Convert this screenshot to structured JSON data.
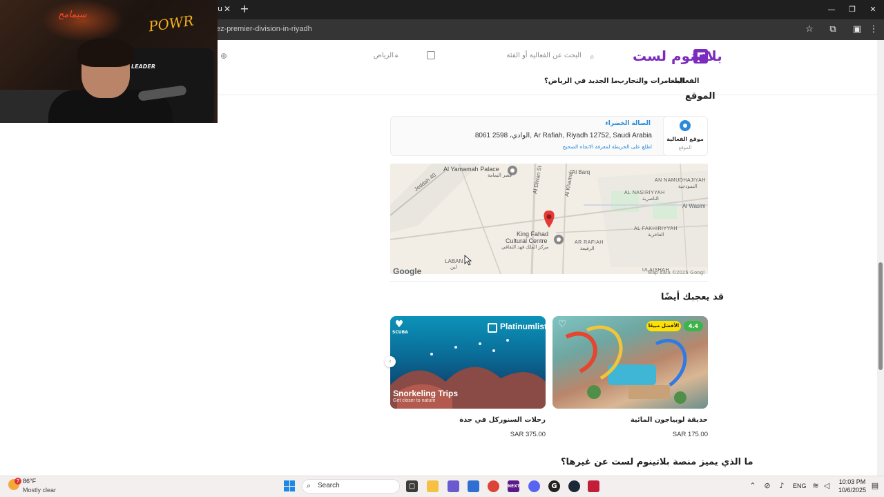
{
  "browser": {
    "tab_stub": "u",
    "url": "ez-premier-division-in-riyadh",
    "close_tab": "✕",
    "new_tab": "+",
    "win_min": "—",
    "win_max": "❐",
    "win_close": "✕"
  },
  "webcam": {
    "neon_sign": "POWR",
    "neon_sign_small": "سيمامح",
    "chair_brand": "LEADER"
  },
  "header": {
    "logo": "بلاتينوم لست",
    "search_placeholder": "البحث عن الفعالية أو الفئة",
    "city": "الرياض"
  },
  "nav": {
    "items": [
      {
        "label": "الفعاليات"
      },
      {
        "label": "المغامرات والتجارب"
      },
      {
        "label": "ما الجديد في الرياض؟"
      }
    ]
  },
  "location_section": {
    "title": "الموقع",
    "badge_title": "موقع الفعالية",
    "badge_sub": "الموقع",
    "venue_name": "الصالة الخضراء",
    "address": "8061 الوادي، 2598, Ar Rafiah, Riyadh 12752, Saudi Arabia",
    "directions_link": "اطلع على الخريطة لمعرفة الاتجاه الصحيح"
  },
  "map": {
    "labels": {
      "al_yamamah": "Al Yamamah Palace",
      "al_yamamah_ar": "قصر اليمامة",
      "al_barq": "Al Barq",
      "an_namudhajiyah": "AN NAMUDHAJIYAH",
      "an_namudhajiyah_ar": "النموذجية",
      "al_nasiriyyah": "AL NASIRIYYAH",
      "al_nasiriyyah_ar": "الناصرية",
      "al_wasim": "Al Wasim",
      "al_diwan": "Al Diwan St",
      "al_khamah": "Al Khamah",
      "jeddah_rd": "Jeddah 40",
      "king_fahad": "King Fahad",
      "cultural_centre": "Cultural Centre",
      "king_fahad_ar": "مركز الملك فهد الثقافي",
      "ar_rafiah": "AR RAFIAH",
      "ar_rafiah_ar": "الرفيعة",
      "al_fakhiriyyah": "AL FAKHIRIYYAH",
      "al_fakhiriyyah_ar": "الفاخرية",
      "laban": "LABAN",
      "laban_ar": "لبن",
      "ulaishah": "ULAISHAH",
      "google": "Google",
      "map_data": "Map data ©2025 Googl"
    }
  },
  "recommend_section": {
    "title": "قد يعجبك أيضًا",
    "cards": [
      {
        "name": "حديقة لوبياجون المائية",
        "price": "SAR 175.00",
        "badge_best": "الأفضل مبيعًا",
        "rating": "4.4"
      },
      {
        "name": "رحلات السنوركل في جدة",
        "price": "SAR 375.00",
        "brand": "Platinumlist",
        "image_title": "Snorkeling Trips",
        "image_sub": "Get closer to nature",
        "scuba_label": "SCUBA"
      }
    ]
  },
  "why_section": {
    "title": "ما الذي يميز منصة بلاتينوم لست عن غيرها؟"
  },
  "taskbar": {
    "weather_temp": "86°F",
    "weather_desc": "Mostly clear",
    "weather_alert": "7",
    "search": "Search",
    "lang": "ENG",
    "time": "10:03 PM",
    "date": "10/6/2025",
    "apps": [
      {
        "name": "file-explorer",
        "color": "#f5c043"
      },
      {
        "name": "copilot",
        "color": "#6a5acd"
      },
      {
        "name": "store",
        "color": "#2f6fd1"
      },
      {
        "name": "chrome",
        "color": "#db4437"
      },
      {
        "name": "next",
        "color": "#5b1a8a"
      },
      {
        "name": "discord",
        "color": "#5865f2"
      },
      {
        "name": "app-g",
        "color": "#222222"
      },
      {
        "name": "app-steam",
        "color": "#1b2838"
      },
      {
        "name": "app-x",
        "color": "#c21e3a"
      }
    ]
  },
  "colors": {
    "brand_purple": "#7b2cbf",
    "link_blue": "#2b8bd9",
    "best_seller_yellow": "#ffe100",
    "rating_green": "#3bb54a"
  }
}
